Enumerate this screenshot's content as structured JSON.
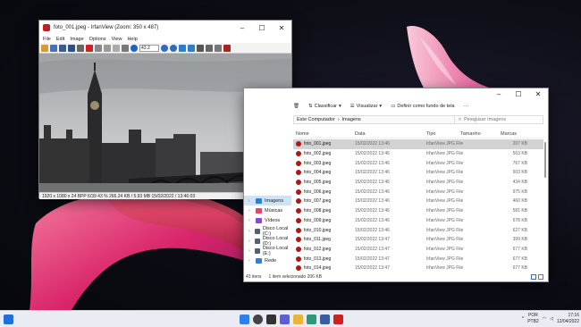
{
  "irfanview": {
    "title": "foto_001.jpeg - IrfanView (Zoom: 350 x 487)",
    "menu": [
      "File",
      "Edit",
      "Image",
      "Options",
      "View",
      "Help"
    ],
    "zoom": "43.2",
    "status": "1920 x 1080 x 24 BPP    6/39    43 %    266.24 KB / 5.93 MB    15/02/2022 / 13:46:03"
  },
  "explorer": {
    "cmd": {
      "sort": "Classificar",
      "view": "Visualizar",
      "wallpaper": "Definir como fundo de tela",
      "more": "···"
    },
    "breadcrumb": [
      "Este Computador",
      "Imagens"
    ],
    "search_placeholder": "Pesquisar Imagens",
    "columns": [
      "Nome",
      "Data",
      "Tipo",
      "Tamanho",
      "Marcas"
    ],
    "files": [
      {
        "name": "foto_001.jpeg",
        "date": "15/02/2022 13:46",
        "type": "IrfanView JPG File",
        "size": "207 KB"
      },
      {
        "name": "foto_002.jpeg",
        "date": "15/02/2022 13:46",
        "type": "IrfanView JPG File",
        "size": "563 KB"
      },
      {
        "name": "foto_003.jpeg",
        "date": "15/02/2022 13:46",
        "type": "IrfanView JPG File",
        "size": "767 KB"
      },
      {
        "name": "foto_004.jpeg",
        "date": "15/02/2022 13:46",
        "type": "IrfanView JPG File",
        "size": "603 KB"
      },
      {
        "name": "foto_005.jpeg",
        "date": "15/02/2022 13:46",
        "type": "IrfanView JPG File",
        "size": "434 KB"
      },
      {
        "name": "foto_006.jpeg",
        "date": "15/02/2022 13:46",
        "type": "IrfanView JPG File",
        "size": "975 KB"
      },
      {
        "name": "foto_007.jpeg",
        "date": "15/02/2022 13:46",
        "type": "IrfanView JPG File",
        "size": "460 KB"
      },
      {
        "name": "foto_008.jpeg",
        "date": "15/02/2022 13:46",
        "type": "IrfanView JPG File",
        "size": "581 KB"
      },
      {
        "name": "foto_009.jpeg",
        "date": "15/02/2022 13:46",
        "type": "IrfanView JPG File",
        "size": "678 KB"
      },
      {
        "name": "foto_010.jpeg",
        "date": "15/02/2022 13:46",
        "type": "IrfanView JPG File",
        "size": "627 KB"
      },
      {
        "name": "foto_011.jpeg",
        "date": "15/02/2022 13:47",
        "type": "IrfanView JPG File",
        "size": "399 KB"
      },
      {
        "name": "foto_012.jpeg",
        "date": "15/02/2022 13:47",
        "type": "IrfanView JPG File",
        "size": "677 KB"
      },
      {
        "name": "foto_013.jpeg",
        "date": "15/02/2022 13:47",
        "type": "IrfanView JPG File",
        "size": "677 KB"
      },
      {
        "name": "foto_014.jpeg",
        "date": "15/02/2022 13:47",
        "type": "IrfanView JPG File",
        "size": "677 KB"
      }
    ],
    "nav": [
      {
        "label": "Imagens",
        "color": "#2f7fd0"
      },
      {
        "label": "Músicas",
        "color": "#e0486a"
      },
      {
        "label": "Vídeos",
        "color": "#8a4ad0"
      },
      {
        "label": "Disco Local (C:)",
        "color": "#556070"
      },
      {
        "label": "Disco Local (D:)",
        "color": "#556070"
      },
      {
        "label": "Disco Local (E:)",
        "color": "#556070"
      },
      {
        "label": "Rede",
        "color": "#3a7bd5"
      }
    ],
    "status_items": "43 itens",
    "status_selected": "1 item selecionado  206 KB"
  },
  "taskbar": {
    "lang1": "POR",
    "lang2": "PTB2",
    "time": "17:16",
    "date": "12/04/2022"
  }
}
